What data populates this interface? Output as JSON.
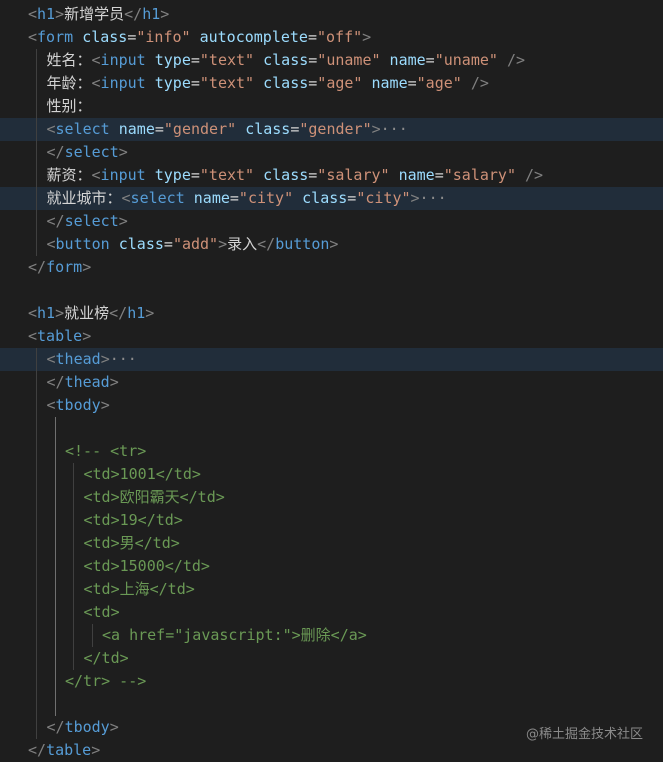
{
  "lines": [
    {
      "indent": 0,
      "hl": false,
      "tokens": [
        [
          "p",
          "<"
        ],
        [
          "t",
          "h1"
        ],
        [
          "p",
          ">"
        ],
        [
          "x",
          "新增学员"
        ],
        [
          "p",
          "</"
        ],
        [
          "t",
          "h1"
        ],
        [
          "p",
          ">"
        ]
      ]
    },
    {
      "indent": 0,
      "hl": false,
      "tokens": [
        [
          "p",
          "<"
        ],
        [
          "t",
          "form"
        ],
        [
          "x",
          " "
        ],
        [
          "a",
          "class"
        ],
        [
          "x",
          "="
        ],
        [
          "s",
          "\"info\""
        ],
        [
          "x",
          " "
        ],
        [
          "a",
          "autocomplete"
        ],
        [
          "x",
          "="
        ],
        [
          "s",
          "\"off\""
        ],
        [
          "p",
          ">"
        ]
      ]
    },
    {
      "indent": 1,
      "hl": false,
      "tokens": [
        [
          "x",
          "姓名："
        ],
        [
          "p",
          "<"
        ],
        [
          "t",
          "input"
        ],
        [
          "x",
          " "
        ],
        [
          "a",
          "type"
        ],
        [
          "x",
          "="
        ],
        [
          "s",
          "\"text\""
        ],
        [
          "x",
          " "
        ],
        [
          "a",
          "class"
        ],
        [
          "x",
          "="
        ],
        [
          "s",
          "\"uname\""
        ],
        [
          "x",
          " "
        ],
        [
          "a",
          "name"
        ],
        [
          "x",
          "="
        ],
        [
          "s",
          "\"uname\""
        ],
        [
          "x",
          " "
        ],
        [
          "p",
          "/>"
        ]
      ]
    },
    {
      "indent": 1,
      "hl": false,
      "tokens": [
        [
          "x",
          "年龄："
        ],
        [
          "p",
          "<"
        ],
        [
          "t",
          "input"
        ],
        [
          "x",
          " "
        ],
        [
          "a",
          "type"
        ],
        [
          "x",
          "="
        ],
        [
          "s",
          "\"text\""
        ],
        [
          "x",
          " "
        ],
        [
          "a",
          "class"
        ],
        [
          "x",
          "="
        ],
        [
          "s",
          "\"age\""
        ],
        [
          "x",
          " "
        ],
        [
          "a",
          "name"
        ],
        [
          "x",
          "="
        ],
        [
          "s",
          "\"age\""
        ],
        [
          "x",
          " "
        ],
        [
          "p",
          "/>"
        ]
      ]
    },
    {
      "indent": 1,
      "hl": false,
      "tokens": [
        [
          "x",
          "性别："
        ]
      ]
    },
    {
      "indent": 1,
      "hl": true,
      "tokens": [
        [
          "p",
          "<"
        ],
        [
          "t",
          "select"
        ],
        [
          "x",
          " "
        ],
        [
          "a",
          "name"
        ],
        [
          "x",
          "="
        ],
        [
          "s",
          "\"gender\""
        ],
        [
          "x",
          " "
        ],
        [
          "a",
          "class"
        ],
        [
          "x",
          "="
        ],
        [
          "s",
          "\"gender\""
        ],
        [
          "p",
          ">"
        ],
        [
          "f",
          "···"
        ]
      ]
    },
    {
      "indent": 1,
      "hl": false,
      "tokens": [
        [
          "p",
          "</"
        ],
        [
          "t",
          "select"
        ],
        [
          "p",
          ">"
        ]
      ]
    },
    {
      "indent": 1,
      "hl": false,
      "tokens": [
        [
          "x",
          "薪资："
        ],
        [
          "p",
          "<"
        ],
        [
          "t",
          "input"
        ],
        [
          "x",
          " "
        ],
        [
          "a",
          "type"
        ],
        [
          "x",
          "="
        ],
        [
          "s",
          "\"text\""
        ],
        [
          "x",
          " "
        ],
        [
          "a",
          "class"
        ],
        [
          "x",
          "="
        ],
        [
          "s",
          "\"salary\""
        ],
        [
          "x",
          " "
        ],
        [
          "a",
          "name"
        ],
        [
          "x",
          "="
        ],
        [
          "s",
          "\"salary\""
        ],
        [
          "x",
          " "
        ],
        [
          "p",
          "/>"
        ]
      ]
    },
    {
      "indent": 1,
      "hl": true,
      "tokens": [
        [
          "x",
          "就业城市："
        ],
        [
          "p",
          "<"
        ],
        [
          "t",
          "select"
        ],
        [
          "x",
          " "
        ],
        [
          "a",
          "name"
        ],
        [
          "x",
          "="
        ],
        [
          "s",
          "\"city\""
        ],
        [
          "x",
          " "
        ],
        [
          "a",
          "class"
        ],
        [
          "x",
          "="
        ],
        [
          "s",
          "\"city\""
        ],
        [
          "p",
          ">"
        ],
        [
          "f",
          "···"
        ]
      ]
    },
    {
      "indent": 1,
      "hl": false,
      "tokens": [
        [
          "p",
          "</"
        ],
        [
          "t",
          "select"
        ],
        [
          "p",
          ">"
        ]
      ]
    },
    {
      "indent": 1,
      "hl": false,
      "tokens": [
        [
          "p",
          "<"
        ],
        [
          "t",
          "button"
        ],
        [
          "x",
          " "
        ],
        [
          "a",
          "class"
        ],
        [
          "x",
          "="
        ],
        [
          "s",
          "\"add\""
        ],
        [
          "p",
          ">"
        ],
        [
          "x",
          "录入"
        ],
        [
          "p",
          "</"
        ],
        [
          "t",
          "button"
        ],
        [
          "p",
          ">"
        ]
      ]
    },
    {
      "indent": 0,
      "hl": false,
      "tokens": [
        [
          "p",
          "</"
        ],
        [
          "t",
          "form"
        ],
        [
          "p",
          ">"
        ]
      ]
    },
    {
      "indent": 0,
      "hl": false,
      "tokens": []
    },
    {
      "indent": 0,
      "hl": false,
      "tokens": [
        [
          "p",
          "<"
        ],
        [
          "t",
          "h1"
        ],
        [
          "p",
          ">"
        ],
        [
          "x",
          "就业榜"
        ],
        [
          "p",
          "</"
        ],
        [
          "t",
          "h1"
        ],
        [
          "p",
          ">"
        ]
      ]
    },
    {
      "indent": 0,
      "hl": false,
      "tokens": [
        [
          "p",
          "<"
        ],
        [
          "t",
          "table"
        ],
        [
          "p",
          ">"
        ]
      ]
    },
    {
      "indent": 1,
      "hl": true,
      "tokens": [
        [
          "p",
          "<"
        ],
        [
          "t",
          "thead"
        ],
        [
          "p",
          ">"
        ],
        [
          "f",
          "···"
        ]
      ]
    },
    {
      "indent": 1,
      "hl": false,
      "tokens": [
        [
          "p",
          "</"
        ],
        [
          "t",
          "thead"
        ],
        [
          "p",
          ">"
        ]
      ]
    },
    {
      "indent": 1,
      "hl": false,
      "tokens": [
        [
          "p",
          "<"
        ],
        [
          "t",
          "tbody"
        ],
        [
          "p",
          ">"
        ]
      ]
    },
    {
      "indent": 2,
      "hl": false,
      "tokens": []
    },
    {
      "indent": 2,
      "hl": false,
      "tokens": [
        [
          "c",
          "<!-- <tr>"
        ]
      ]
    },
    {
      "indent": 3,
      "hl": false,
      "tokens": [
        [
          "c",
          "<td>1001</td>"
        ]
      ]
    },
    {
      "indent": 3,
      "hl": false,
      "tokens": [
        [
          "c",
          "<td>欧阳霸天</td>"
        ]
      ]
    },
    {
      "indent": 3,
      "hl": false,
      "tokens": [
        [
          "c",
          "<td>19</td>"
        ]
      ]
    },
    {
      "indent": 3,
      "hl": false,
      "tokens": [
        [
          "c",
          "<td>男</td>"
        ]
      ]
    },
    {
      "indent": 3,
      "hl": false,
      "tokens": [
        [
          "c",
          "<td>15000</td>"
        ]
      ]
    },
    {
      "indent": 3,
      "hl": false,
      "tokens": [
        [
          "c",
          "<td>上海</td>"
        ]
      ]
    },
    {
      "indent": 3,
      "hl": false,
      "tokens": [
        [
          "c",
          "<td>"
        ]
      ]
    },
    {
      "indent": 4,
      "hl": false,
      "tokens": [
        [
          "c",
          "<a href=\"javascript:\">删除</a>"
        ]
      ]
    },
    {
      "indent": 3,
      "hl": false,
      "tokens": [
        [
          "c",
          "</td>"
        ]
      ]
    },
    {
      "indent": 2,
      "hl": false,
      "tokens": [
        [
          "c",
          "</tr> -->"
        ]
      ]
    },
    {
      "indent": 2,
      "hl": false,
      "tokens": []
    },
    {
      "indent": 1,
      "hl": false,
      "tokens": [
        [
          "p",
          "</"
        ],
        [
          "t",
          "tbody"
        ],
        [
          "p",
          ">"
        ]
      ]
    },
    {
      "indent": 0,
      "hl": false,
      "tokens": [
        [
          "p",
          "</"
        ],
        [
          "t",
          "table"
        ],
        [
          "p",
          ">"
        ]
      ]
    }
  ],
  "watermark": "@稀土掘金技术社区",
  "theme_colors": {
    "background": "#1e1e1e",
    "tag": "#569cd6",
    "attribute": "#9cdcfe",
    "string": "#ce9178",
    "comment": "#6a9955",
    "punctuation": "#808080",
    "text": "#d4d4d4",
    "line_highlight": "#212d3a"
  }
}
